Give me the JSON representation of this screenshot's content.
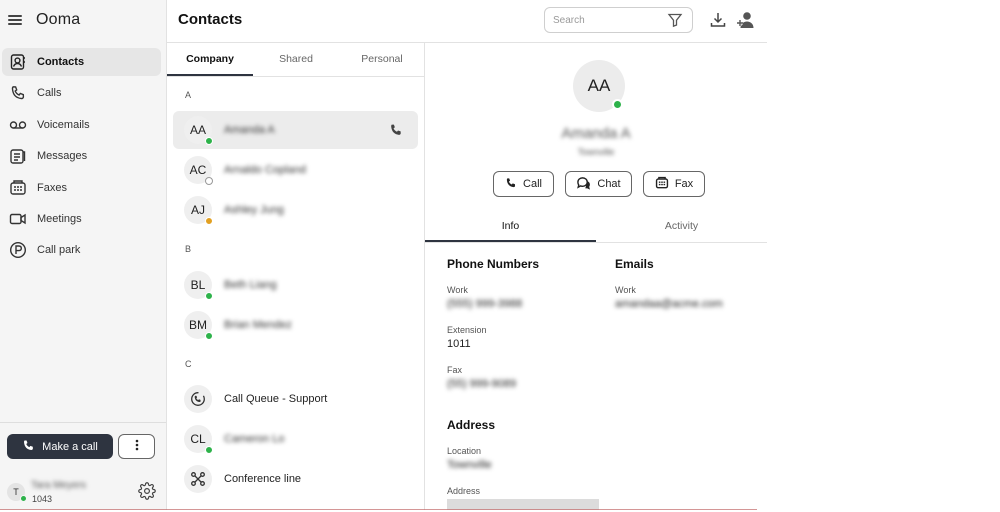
{
  "app": {
    "brand": "Ooma"
  },
  "sidebar": {
    "items": [
      {
        "label": "Contacts",
        "icon": "contacts-icon",
        "active": true
      },
      {
        "label": "Calls",
        "icon": "phone-icon",
        "active": false
      },
      {
        "label": "Voicemails",
        "icon": "voicemail-icon",
        "active": false
      },
      {
        "label": "Messages",
        "icon": "messages-icon",
        "active": false
      },
      {
        "label": "Faxes",
        "icon": "fax-icon",
        "active": false
      },
      {
        "label": "Meetings",
        "icon": "video-icon",
        "active": false
      },
      {
        "label": "Call park",
        "icon": "parking-icon",
        "active": false
      }
    ],
    "make_call_label": "Make a call",
    "user": {
      "initial": "T",
      "name": "Tara Meyers",
      "extension": "1043"
    }
  },
  "header": {
    "title": "Contacts",
    "search_placeholder": "Search"
  },
  "list": {
    "tabs": [
      "Company",
      "Shared",
      "Personal"
    ],
    "active_tab": "Company",
    "sections": [
      {
        "letter": "A",
        "contacts": [
          {
            "initials": "AA",
            "name": "Amanda A",
            "status": "available",
            "selected": true
          },
          {
            "initials": "AC",
            "name": "Arnaldo Copland",
            "status": "offline"
          },
          {
            "initials": "AJ",
            "name": "Ashley Jung",
            "status": "away"
          }
        ]
      },
      {
        "letter": "B",
        "contacts": [
          {
            "initials": "BL",
            "name": "Beth Liang",
            "status": "available"
          },
          {
            "initials": "BM",
            "name": "Brian Mendez",
            "status": "available"
          }
        ]
      },
      {
        "letter": "C",
        "contacts": [
          {
            "name": "Call Queue - Support",
            "icon": "call-queue-icon"
          },
          {
            "initials": "CL",
            "name": "Cameron Lo",
            "status": "available"
          },
          {
            "name": "Conference line",
            "icon": "conference-icon"
          }
        ]
      }
    ]
  },
  "detail": {
    "initials": "AA",
    "name": "Amanda A",
    "location": "Townville",
    "actions": {
      "call": "Call",
      "chat": "Chat",
      "fax": "Fax"
    },
    "tabs": [
      "Info",
      "Activity"
    ],
    "active_tab": "Info",
    "phone_numbers": {
      "title": "Phone Numbers",
      "work_label": "Work",
      "work_value": "(555) 999-3988",
      "extension_label": "Extension",
      "extension_value": "1011",
      "fax_label": "Fax",
      "fax_value": "(55) 999-9089"
    },
    "emails": {
      "title": "Emails",
      "work_label": "Work",
      "work_value": "amandaa@acme.com"
    },
    "address": {
      "title": "Address",
      "location_label": "Location",
      "location_value": "Townville",
      "address_label": "Address"
    }
  },
  "colors": {
    "accent_dark": "#2e3440",
    "available": "#2db24a",
    "away": "#e2a021"
  }
}
